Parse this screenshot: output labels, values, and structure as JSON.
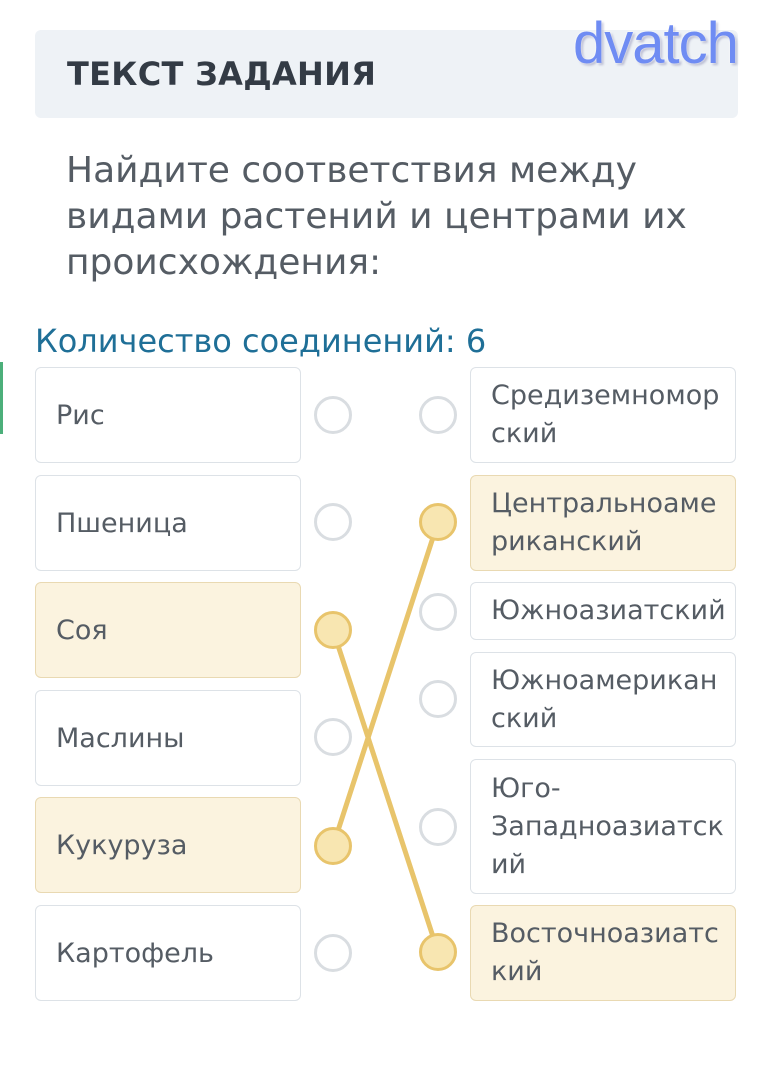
{
  "header": {
    "title": "ТЕКСТ ЗАДАНИЯ"
  },
  "watermark": "dvatch",
  "question": "Найдите соответствия между видами растений и центрами их происхождения:",
  "connections": {
    "label": "Количество соединений: 6"
  },
  "left_items": [
    {
      "label": "Рис",
      "selected": false
    },
    {
      "label": "Пшеница",
      "selected": false
    },
    {
      "label": "Соя",
      "selected": true
    },
    {
      "label": "Маслины",
      "selected": false
    },
    {
      "label": "Кукуруза",
      "selected": true
    },
    {
      "label": "Картофель",
      "selected": false
    }
  ],
  "right_items": [
    {
      "label": "Средиземномор ский",
      "selected": false
    },
    {
      "label": "Центральноаме риканский",
      "selected": true
    },
    {
      "label": "Южноазиатский",
      "selected": false
    },
    {
      "label": "Южноамерикан ский",
      "selected": false
    },
    {
      "label": "Юго- Западноазиатск ий",
      "selected": false
    },
    {
      "label": "Восточноазиатс кий",
      "selected": true
    }
  ],
  "links": [
    {
      "from": "Соя",
      "to": "Восточноазиатс кий"
    },
    {
      "from": "Кукуруза",
      "to": "Центральноаме риканский"
    }
  ],
  "colors": {
    "link": "#e8c46b",
    "selected_fill": "#fbf3df",
    "accent_text": "#1f6f97"
  }
}
